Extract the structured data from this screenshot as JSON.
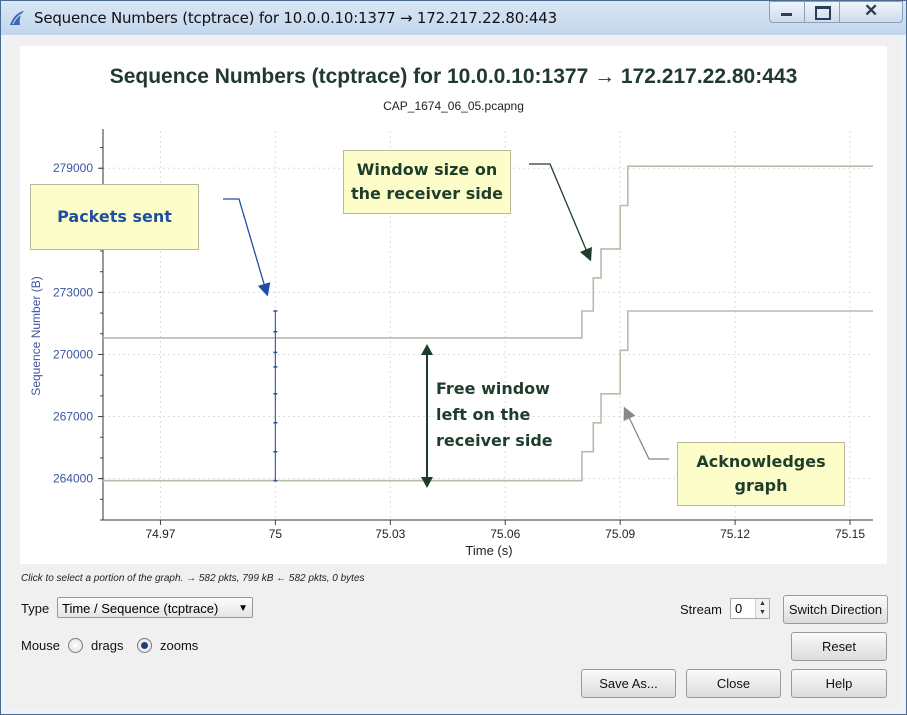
{
  "window": {
    "title": "Sequence Numbers (tcptrace) for 10.0.0.10:1377 → 172.217.22.80:443"
  },
  "chart_data": {
    "type": "line",
    "title": "Sequence Numbers (tcptrace) for 10.0.0.10:1377 → 172.217.22.80:443",
    "subtitle": "CAP_1674_06_05.pcapng",
    "xlabel": "Time (s)",
    "ylabel": "Sequence Number (B)",
    "xlim": [
      74.955,
      75.156
    ],
    "ylim": [
      262000,
      280800
    ],
    "x_ticks": [
      "74.97",
      "75",
      "75.03",
      "75.06",
      "75.09",
      "75.12",
      "75.15"
    ],
    "y_ticks": [
      "264000",
      "267000",
      "270000",
      "273000",
      "279000"
    ],
    "grid": true,
    "series": [
      {
        "name": "",
        "points": [
          [
            74.955,
            270800
          ],
          [
            75.08,
            270800
          ],
          [
            75.08,
            272100
          ],
          [
            75.083,
            272100
          ],
          [
            75.083,
            273700
          ],
          [
            75.085,
            273700
          ],
          [
            75.085,
            275100
          ],
          [
            75.09,
            275100
          ],
          [
            75.09,
            277200
          ],
          [
            75.092,
            277200
          ],
          [
            75.092,
            279100
          ],
          [
            75.156,
            279100
          ]
        ]
      },
      {
        "name": "",
        "points": [
          [
            74.955,
            263900
          ],
          [
            75.08,
            263900
          ],
          [
            75.08,
            265300
          ],
          [
            75.083,
            265300
          ],
          [
            75.083,
            266700
          ],
          [
            75.085,
            266700
          ],
          [
            75.085,
            268100
          ],
          [
            75.09,
            268100
          ],
          [
            75.09,
            270200
          ],
          [
            75.092,
            270200
          ],
          [
            75.092,
            272100
          ],
          [
            75.156,
            272100
          ]
        ]
      },
      {
        "name": "",
        "type": "segments",
        "x": 75.0,
        "y_from": 263900,
        "y_to": 272100,
        "markers": [
          263900,
          265300,
          266700,
          268100,
          269400,
          270100,
          271100,
          272100
        ]
      }
    ],
    "annotations": [
      {
        "text": "Packets sent"
      },
      {
        "text": "Window  size on the receiver side"
      },
      {
        "text": "Free window left on the receiver side"
      },
      {
        "text": "Acknowledges graph"
      }
    ]
  },
  "annotations": {
    "packets_sent": "Packets sent",
    "window_size_line1": "Window  size on",
    "window_size_line2": "the receiver side",
    "free_window_line1": "Free window",
    "free_window_line2": "left on the",
    "free_window_line3": "receiver side",
    "acknowledges_line1": "Acknowledges",
    "acknowledges_line2": "graph"
  },
  "status_text": "Click to select a portion of the graph. → 582 pkts, 799 kB ← 582 pkts, 0 bytes",
  "controls": {
    "type_label": "Type",
    "type_value": "Time / Sequence (tcptrace)",
    "mouse_label": "Mouse",
    "drags_label": "drags",
    "zooms_label": "zooms",
    "mouse_selected": "zooms",
    "stream_label": "Stream",
    "stream_value": "0",
    "switch_direction": "Switch Direction",
    "reset": "Reset",
    "save_as": "Save As...",
    "close": "Close",
    "help": "Help"
  }
}
